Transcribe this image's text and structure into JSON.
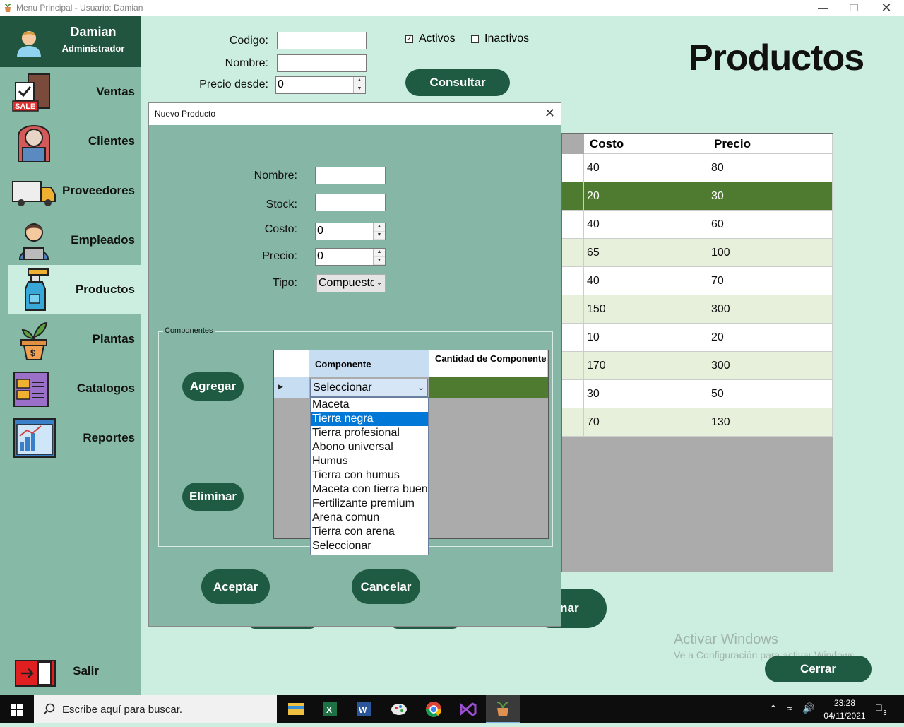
{
  "window": {
    "title": "Menu Principal - Usuario: Damian"
  },
  "user": {
    "name": "Damian",
    "role": "Administrador"
  },
  "sidebar": {
    "items": [
      {
        "label": "Ventas",
        "icon": "sale-bag-icon"
      },
      {
        "label": "Clientes",
        "icon": "customer-icon"
      },
      {
        "label": "Proveedores",
        "icon": "delivery-truck-icon"
      },
      {
        "label": "Empleados",
        "icon": "employee-laptop-icon"
      },
      {
        "label": "Productos",
        "icon": "spray-bottle-icon"
      },
      {
        "label": "Plantas",
        "icon": "plant-pot-icon"
      },
      {
        "label": "Catalogos",
        "icon": "catalog-icon"
      },
      {
        "label": "Reportes",
        "icon": "report-chart-icon"
      }
    ],
    "exit_label": "Salir",
    "active": "Productos"
  },
  "filters": {
    "codigo_label": "Codigo:",
    "codigo_value": "",
    "nombre_label": "Nombre:",
    "nombre_value": "",
    "precio_desde_label": "Precio desde:",
    "precio_desde_value": "0",
    "activos_label": "Activos",
    "activos_checked": true,
    "inactivos_label": "Inactivos",
    "inactivos_checked": false,
    "consultar_label": "Consultar"
  },
  "page_title": "Productos",
  "products_table": {
    "columns": [
      "Costo",
      "Precio"
    ],
    "rows": [
      [
        "40",
        "80"
      ],
      [
        "20",
        "30"
      ],
      [
        "40",
        "60"
      ],
      [
        "65",
        "100"
      ],
      [
        "40",
        "70"
      ],
      [
        "150",
        "300"
      ],
      [
        "10",
        "20"
      ],
      [
        "170",
        "300"
      ],
      [
        "30",
        "50"
      ],
      [
        "70",
        "130"
      ]
    ],
    "selected_row": 1
  },
  "hidden_button_label": "ninar",
  "cerrar_label": "Cerrar",
  "dialog": {
    "title": "Nuevo Producto",
    "nombre_label": "Nombre:",
    "nombre_value": "",
    "stock_label": "Stock:",
    "stock_value": "",
    "costo_label": "Costo:",
    "costo_value": "0",
    "precio_label": "Precio:",
    "precio_value": "0",
    "tipo_label": "Tipo:",
    "tipo_value": "Compuesto",
    "group_label": "Componentes",
    "agregar_label": "Agregar",
    "eliminar_label": "Eliminar",
    "aceptar_label": "Aceptar",
    "cancelar_label": "Cancelar",
    "grid_columns": [
      "Componente",
      "Cantidad de Componente"
    ],
    "combo_value": "Seleccionar",
    "dropdown_options": [
      "Maceta",
      "Tierra negra",
      "Tierra profesional",
      "Abono universal",
      "Humus",
      "Tierra con humus",
      "Maceta con tierra buen",
      "Fertilizante premium",
      "Arena comun",
      "Tierra con arena",
      "Seleccionar"
    ],
    "dropdown_selected": 1
  },
  "watermark": {
    "line1": "Activar Windows",
    "line2": "Ve a Configuración para activar Windows."
  },
  "taskbar": {
    "search_placeholder": "Escribe aquí para buscar.",
    "time": "23:28",
    "date": "04/11/2021",
    "notifications": "3",
    "apps": [
      "file-explorer-icon",
      "excel-icon",
      "word-icon",
      "paint-icon",
      "chrome-icon",
      "visual-studio-icon",
      "plant-app-icon"
    ]
  },
  "colors": {
    "accent_dark": "#1f5a43",
    "sidebar": "#86b9a6",
    "background": "#cceee0",
    "selected_row": "#4e7b30",
    "alt_row": "#e6f0da"
  }
}
